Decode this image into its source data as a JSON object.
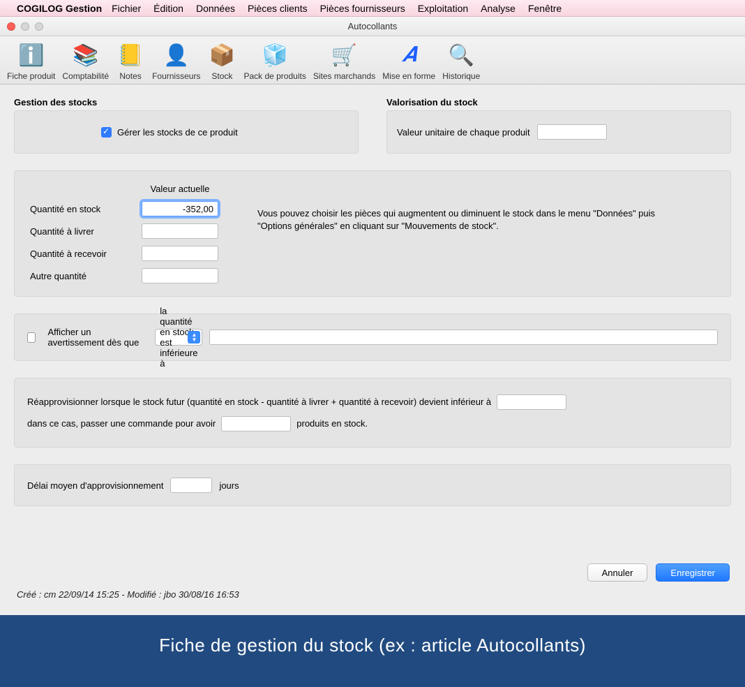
{
  "menubar": {
    "app": "COGILOG Gestion",
    "items": [
      "Fichier",
      "Édition",
      "Données",
      "Pièces clients",
      "Pièces fournisseurs",
      "Exploitation",
      "Analyse",
      "Fenêtre"
    ]
  },
  "window": {
    "title": "Autocollants"
  },
  "toolbar": {
    "items": [
      {
        "label": "Fiche produit",
        "glyph": "ℹ️"
      },
      {
        "label": "Comptabilité",
        "glyph": "📚"
      },
      {
        "label": "Notes",
        "glyph": "📒"
      },
      {
        "label": "Fournisseurs",
        "glyph": "👤"
      },
      {
        "label": "Stock",
        "glyph": "📦"
      },
      {
        "label": "Pack de produits",
        "glyph": "🧊"
      },
      {
        "label": "Sites marchands",
        "glyph": "🛒"
      },
      {
        "label": "Mise en forme",
        "glyph": "𝑨"
      },
      {
        "label": "Historique",
        "glyph": "🔍"
      }
    ]
  },
  "stock": {
    "title": "Gestion des stocks",
    "manage": "Gérer les stocks de ce produit"
  },
  "valuation": {
    "title": "Valorisation du stock",
    "label": "Valeur unitaire de chaque produit",
    "value": ""
  },
  "qty": {
    "header": "Valeur actuelle",
    "rows": {
      "instock": {
        "label": "Quantité en stock",
        "value": "-352,00"
      },
      "deliver": {
        "label": "Quantité à livrer",
        "value": ""
      },
      "receive": {
        "label": "Quantité à recevoir",
        "value": ""
      },
      "other": {
        "label": "Autre quantité",
        "value": ""
      }
    },
    "hint": "Vous pouvez choisir les pièces qui augmentent ou diminuent le stock dans le menu \"Données\" puis \"Options générales\" en cliquant sur \"Mouvements de stock\"."
  },
  "warning": {
    "label": "Afficher un avertissement dès que",
    "select": "la quantité en stock est inférieure à",
    "value": ""
  },
  "reorder": {
    "line1_a": "Réapprovisionner lorsque le stock futur (quantité en stock - quantité à livrer + quantité à recevoir) devient inférieur à",
    "val1": "",
    "line2_a": "dans ce cas, passer une commande pour avoir",
    "val2": "",
    "line2_b": "produits en stock."
  },
  "leadtime": {
    "label": "Délai moyen d'approvisionnement",
    "value": "",
    "unit": "jours"
  },
  "footer": {
    "cancel": "Annuler",
    "save": "Enregistrer",
    "meta": "Créé : cm 22/09/14 15:25 - Modifié : jbo 30/08/16 16:53"
  },
  "caption": "Fiche de gestion du stock (ex : article Autocollants)"
}
